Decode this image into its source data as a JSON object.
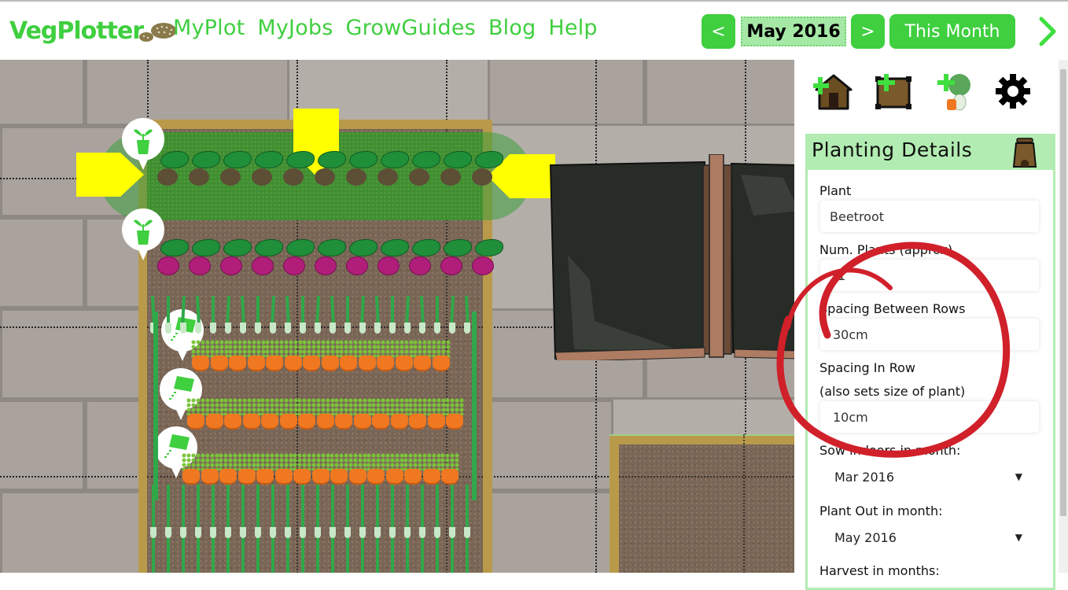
{
  "app": {
    "logo_text": "VegPlotter",
    "logo_icon": "boot-print-icon"
  },
  "nav": {
    "items": [
      {
        "label": "MyPlot"
      },
      {
        "label": "MyJobs"
      },
      {
        "label": "GrowGuides"
      },
      {
        "label": "Blog"
      },
      {
        "label": "Help"
      }
    ]
  },
  "month_nav": {
    "prev_label": "<",
    "current_month": "May 2016",
    "next_label": ">",
    "this_month_label": "This Month",
    "expand_icon": "chevron-right-icon"
  },
  "colors": {
    "brand_green": "#3fcf3f",
    "panel_green": "#b2ecb2",
    "handle_yellow": "#ffff00",
    "annotation_red": "#d0202a",
    "bed_border": "#b89a4a"
  },
  "toolbar": {
    "tools": [
      {
        "name": "add-shed",
        "icon": "add-shed-icon"
      },
      {
        "name": "add-bed",
        "icon": "add-bed-icon"
      },
      {
        "name": "add-plant",
        "icon": "add-plant-icon"
      },
      {
        "name": "settings",
        "icon": "gear-icon"
      }
    ]
  },
  "panel": {
    "title": "Planting Details",
    "header_icon": "seed-sack-icon",
    "fields": {
      "plant": {
        "label": "Plant",
        "value": "Beetroot"
      },
      "num_plants": {
        "label": "Num. Plants (approx)",
        "value": "11"
      },
      "row_spacing": {
        "label": "Spacing Between Rows",
        "value": "30cm"
      },
      "in_row_spacing": {
        "label": "Spacing In Row",
        "sublabel": "(also sets size of plant)",
        "value": "10cm"
      },
      "sow_indoors": {
        "label": "Sow indoors in month:",
        "value": "Mar 2016"
      },
      "plant_out": {
        "label": "Plant Out in month:",
        "value": "May 2016"
      },
      "harvest": {
        "label": "Harvest in months:"
      }
    },
    "dropdown_arrow": "▼"
  },
  "plot": {
    "rows": [
      {
        "crop": "Beetroot",
        "selected": true,
        "marker": "seedling-pot-icon",
        "count": 11
      },
      {
        "crop": "Beetroot",
        "selected": false,
        "marker": "seedling-pot-icon",
        "count": 11
      },
      {
        "crop": "Leek",
        "marker": "none"
      },
      {
        "crop": "Carrot",
        "marker": "seed-packet-icon",
        "count": 14
      },
      {
        "crop": "Carrot",
        "marker": "seed-packet-icon",
        "count": 15
      },
      {
        "crop": "Carrot",
        "marker": "seed-packet-icon",
        "count": 15
      }
    ]
  }
}
